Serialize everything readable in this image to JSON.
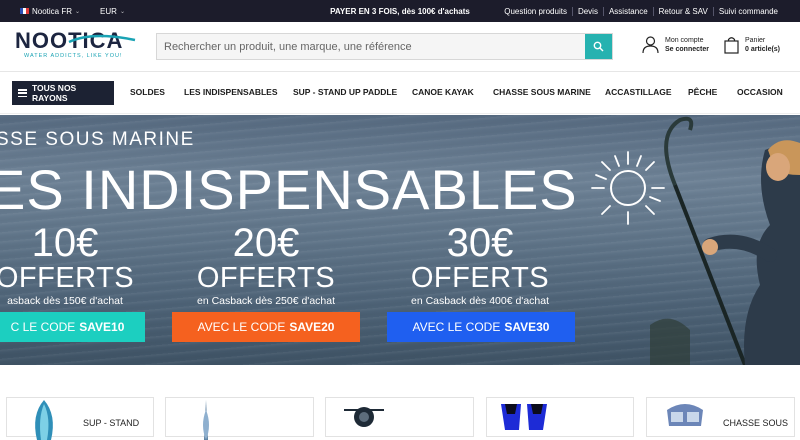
{
  "topbar": {
    "store": "Nootica FR",
    "currency": "EUR",
    "promo": "PAYER EN 3 FOIS, dès 100€ d'achats",
    "links": [
      "Question produits",
      "Devis",
      "Assistance",
      "Retour & SAV",
      "Suivi commande"
    ]
  },
  "header": {
    "logo_name": "NOOTICA",
    "logo_tagline": "WATER ADDICTS, LIKE YOU!",
    "search_placeholder": "Rechercher un produit, une marque, une référence",
    "account_line1": "Mon compte",
    "account_line2": "Se connecter",
    "cart_line1": "Panier",
    "cart_line2": "0 article(s)"
  },
  "nav": {
    "all_label": "TOUS NOS RAYONS",
    "items": [
      "SOLDES",
      "LES INDISPENSABLES",
      "SUP - STAND UP PADDLE",
      "CANOE KAYAK",
      "CHASSE SOUS MARINE",
      "ACCASTILLAGE",
      "PÊCHE",
      "OCCASION"
    ]
  },
  "banner": {
    "subtitle": "SSE SOUS MARINE",
    "title": "ES INDISPENSABLES",
    "offers": [
      {
        "amount": "10€",
        "offert": "OFFERTS",
        "cashback": "asback dès 150€ d'achat",
        "code_prefix": "C LE CODE",
        "code": "SAVE10",
        "color": "#1ccfc0"
      },
      {
        "amount": "20€",
        "offert": "OFFERTS",
        "cashback": "en Casback dès 250€ d'achat",
        "code_prefix": "AVEC LE CODE",
        "code": "SAVE20",
        "color": "#f5611f"
      },
      {
        "amount": "30€",
        "offert": "OFFERTS",
        "cashback": "en Casback dès 400€ d'achat",
        "code_prefix": "AVEC LE CODE",
        "code": "SAVE30",
        "color": "#1f5ff0"
      }
    ]
  },
  "products": [
    {
      "label": "SUP - STAND"
    },
    {
      "label": ""
    },
    {
      "label": ""
    },
    {
      "label": ""
    },
    {
      "label": "CHASSE SOUS"
    }
  ],
  "colors": {
    "topbar": "#1c1c2b",
    "accent": "#26b2b0",
    "nav_button": "#1c2233"
  }
}
